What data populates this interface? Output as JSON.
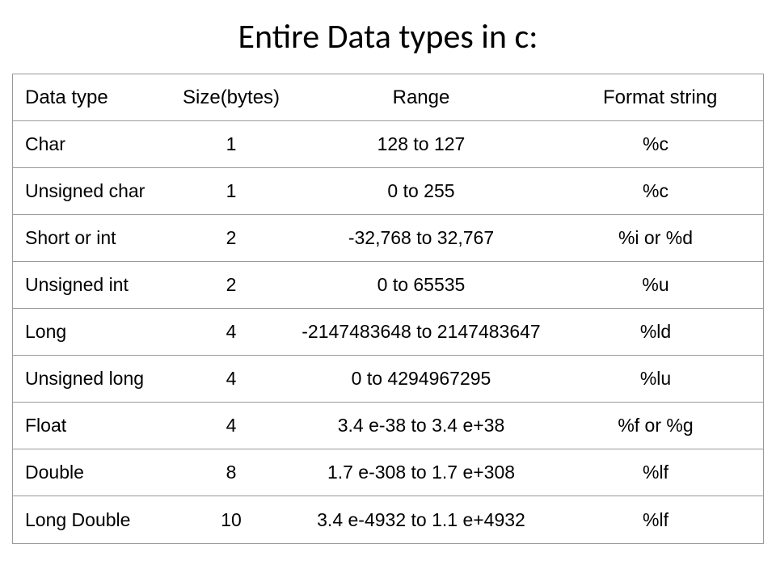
{
  "title": "Entire Data types in c:",
  "headers": {
    "datatype": "Data type",
    "size": "Size(bytes)",
    "range": "Range",
    "format": "Format string"
  },
  "rows": [
    {
      "datatype": "Char",
      "size": "1",
      "range": "128 to 127",
      "format": "%c"
    },
    {
      "datatype": "Unsigned char",
      "size": "1",
      "range": "0 to 255",
      "format": "%c"
    },
    {
      "datatype": "Short or int",
      "size": "2",
      "range": "-32,768 to 32,767",
      "format": "%i or %d"
    },
    {
      "datatype": "Unsigned int",
      "size": "2",
      "range": "0 to 65535",
      "format": "%u"
    },
    {
      "datatype": "Long",
      "size": "4",
      "range": "-2147483648 to 2147483647",
      "format": "%ld"
    },
    {
      "datatype": " Unsigned long",
      "size": "4",
      "range": "0 to 4294967295",
      "format": "%lu"
    },
    {
      "datatype": "Float",
      "size": "4",
      "range": "3.4 e-38 to 3.4 e+38",
      "format": "%f or %g"
    },
    {
      "datatype": "Double",
      "size": "8",
      "range": "1.7 e-308 to 1.7 e+308",
      "format": "%lf"
    },
    {
      "datatype": "Long Double",
      "size": "10",
      "range": "3.4 e-4932 to 1.1 e+4932",
      "format": "%lf"
    }
  ]
}
